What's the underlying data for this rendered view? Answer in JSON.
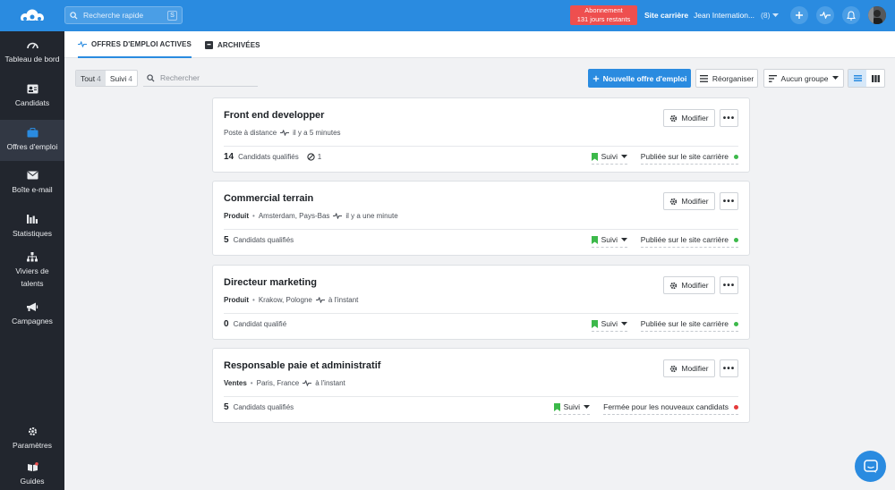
{
  "topbar": {
    "search_placeholder": "Recherche rapide",
    "search_shortcut": "S",
    "promo_line1": "Abonnement",
    "promo_line2": "131 jours restants",
    "site_link": "Site carrière",
    "account_name": "Jean Internation...",
    "account_count": "(8)"
  },
  "sidebar": {
    "items": [
      {
        "label": "Tableau de bord",
        "icon": "dashboard-icon"
      },
      {
        "label": "Candidats",
        "icon": "candidates-icon"
      },
      {
        "label": "Offres d'emploi",
        "icon": "briefcase-icon"
      },
      {
        "label": "Boîte e-mail",
        "icon": "mail-icon"
      },
      {
        "label": "Statistiques",
        "icon": "stats-icon"
      },
      {
        "label": "Viviers de talents",
        "icon": "talent-pool-icon"
      },
      {
        "label": "Campagnes",
        "icon": "megaphone-icon"
      }
    ],
    "settings": "Paramètres",
    "guides": "Guides"
  },
  "tabs": {
    "active": "OFFRES D'EMPLOI ACTIVES",
    "archived": "ARCHIVÉES"
  },
  "toolbar": {
    "all_label": "Tout",
    "all_count": "4",
    "followed_label": "Suivi",
    "followed_count": "4",
    "search_placeholder": "Rechercher",
    "new_job": "Nouvelle offre d'emploi",
    "reorganize": "Réorganiser",
    "group": "Aucun groupe"
  },
  "jobs": [
    {
      "title": "Front end developper",
      "category": "",
      "location": "Poste à distance",
      "activity": "il y a 5 minutes",
      "count": "14",
      "count_label": "Candidats qualifiés",
      "disqualified": "1",
      "follow": "Suivi",
      "status": "Publiée sur le site carrière",
      "status_color": "#3cb94a"
    },
    {
      "title": "Commercial terrain",
      "category": "Produit",
      "location": "Amsterdam, Pays-Bas",
      "activity": "il y a une minute",
      "count": "5",
      "count_label": "Candidats qualifiés",
      "disqualified": "",
      "follow": "Suivi",
      "status": "Publiée sur le site carrière",
      "status_color": "#3cb94a"
    },
    {
      "title": "Directeur marketing",
      "category": "Produit",
      "location": "Krakow, Pologne",
      "activity": "à l'instant",
      "count": "0",
      "count_label": "Candidat qualifié",
      "disqualified": "",
      "follow": "Suivi",
      "status": "Publiée sur le site carrière",
      "status_color": "#3cb94a"
    },
    {
      "title": "Responsable paie et administratif",
      "category": "Ventes",
      "location": "Paris, France",
      "activity": "à l'instant",
      "count": "5",
      "count_label": "Candidats qualifiés",
      "disqualified": "",
      "follow": "Suivi",
      "status": "Fermée pour les nouveaux candidats",
      "status_color": "#e53b3b"
    }
  ],
  "edit_label": "Modifier",
  "more_label": "•••",
  "colors": {
    "accent": "#2a8be0",
    "sidebar": "#22262e",
    "promo": "#ee4f4f"
  }
}
